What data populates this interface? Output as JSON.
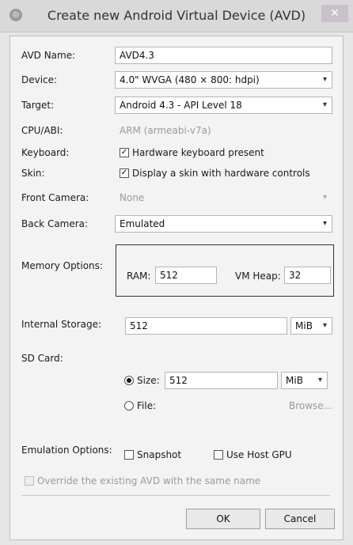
{
  "window": {
    "title": "Create new Android Virtual Device (AVD)"
  },
  "form": {
    "avd_name": {
      "label": "AVD Name:",
      "value": "AVD4.3"
    },
    "device": {
      "label": "Device:",
      "value": "4.0\" WVGA (480 × 800: hdpi)"
    },
    "target": {
      "label": "Target:",
      "value": "Android 4.3 - API Level 18"
    },
    "cpu_abi": {
      "label": "CPU/ABI:",
      "value": "ARM (armeabi-v7a)"
    },
    "keyboard": {
      "label": "Keyboard:",
      "checkbox_label": "Hardware keyboard present",
      "checked": true
    },
    "skin": {
      "label": "Skin:",
      "checkbox_label": "Display a skin with hardware controls",
      "checked": true
    },
    "front_camera": {
      "label": "Front Camera:",
      "value": "None"
    },
    "back_camera": {
      "label": "Back Camera:",
      "value": "Emulated"
    },
    "memory": {
      "label": "Memory Options:",
      "ram_label": "RAM:",
      "ram_value": "512",
      "vm_heap_label": "VM Heap:",
      "vm_heap_value": "32"
    },
    "internal_storage": {
      "label": "Internal Storage:",
      "value": "512",
      "unit": "MiB"
    },
    "sd_card": {
      "label": "SD Card:",
      "size_label": "Size:",
      "size_value": "512",
      "size_unit": "MiB",
      "size_selected": true,
      "file_label": "File:",
      "browse_label": "Browse..."
    },
    "emulation": {
      "label": "Emulation Options:",
      "snapshot_label": "Snapshot",
      "host_gpu_label": "Use Host GPU"
    },
    "override_label": "Override the existing AVD with the same name"
  },
  "buttons": {
    "ok": "OK",
    "cancel": "Cancel"
  },
  "icons": {
    "chevron": "▾",
    "check": "✓",
    "close": "✕",
    "app": "android-sdk-icon"
  }
}
